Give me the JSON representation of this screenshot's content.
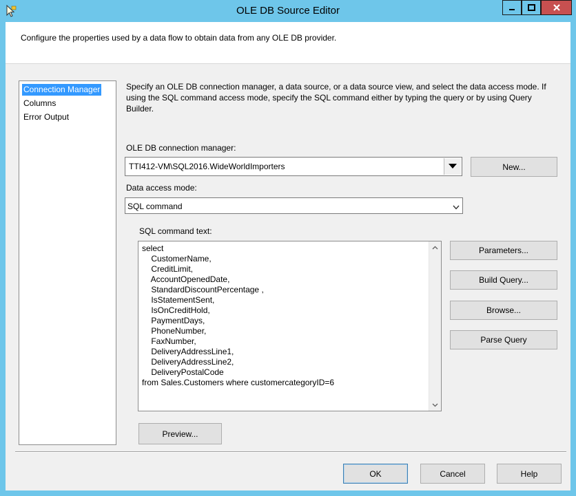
{
  "window": {
    "title": "OLE DB Source Editor",
    "header_text": "Configure the properties used by a data flow to obtain data from any OLE DB provider."
  },
  "nav": {
    "items": [
      {
        "label": "Connection Manager",
        "selected": true
      },
      {
        "label": "Columns",
        "selected": false
      },
      {
        "label": "Error Output",
        "selected": false
      }
    ]
  },
  "page": {
    "description": "Specify an OLE DB connection manager, a data source, or a data source view, and select the data access mode. If using the SQL command access mode, specify the SQL command either by typing the query or by using Query Builder.",
    "connection_label": "OLE DB connection manager:",
    "connection_value": "TTI412-VM\\SQL2016.WideWorldImporters",
    "new_button": "New...",
    "access_mode_label": "Data access mode:",
    "access_mode_value": "SQL command",
    "sql_label": "SQL command text:",
    "sql_text": "select\n    CustomerName,\n    CreditLimit,\n    AccountOpenedDate,\n    StandardDiscountPercentage ,\n    IsStatementSent,\n    IsOnCreditHold,\n    PaymentDays,\n    PhoneNumber,\n    FaxNumber,\n    DeliveryAddressLine1,\n    DeliveryAddressLine2,\n    DeliveryPostalCode\nfrom Sales.Customers where customercategoryID=6",
    "parameters_button": "Parameters...",
    "build_query_button": "Build Query...",
    "browse_button": "Browse...",
    "parse_query_button": "Parse Query",
    "preview_button": "Preview..."
  },
  "footer": {
    "ok_button": "OK",
    "cancel_button": "Cancel",
    "help_button": "Help"
  },
  "colors": {
    "titlebar": "#6ec6ea",
    "close_button": "#c75050",
    "selection": "#3399ff"
  }
}
